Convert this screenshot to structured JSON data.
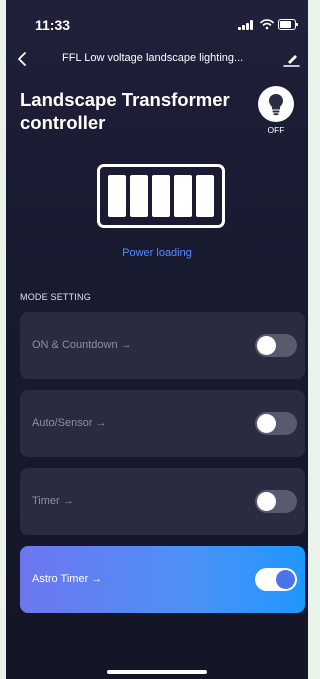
{
  "status_bar": {
    "time": "11:33",
    "icons": [
      "signal-icon",
      "wifi-icon",
      "battery-icon"
    ]
  },
  "nav": {
    "title": "FFL Low voltage landscape lighting...",
    "back_icon": "chevron-left-icon",
    "edit_icon": "edit-icon"
  },
  "header": {
    "title": "Landscape Transformer controller",
    "power_state": "OFF",
    "power_icon": "lightbulb-icon"
  },
  "power": {
    "status_label": "Power loading",
    "segments": 5,
    "icon": "battery-load-icon"
  },
  "mode_section": {
    "label": "MODE SETTING",
    "modes": [
      {
        "label": "ON & Countdown  →",
        "enabled": false
      },
      {
        "label": "Auto/Sensor  →",
        "enabled": false
      },
      {
        "label": "Timer  →",
        "enabled": false
      },
      {
        "label": "Astro Timer  →",
        "enabled": true
      }
    ]
  },
  "colors": {
    "background": "#181a30",
    "card": "#2a2a40",
    "accent": "#4d91f5",
    "link": "#4f8cff",
    "toggle_on_knob": "#4d73e8"
  }
}
